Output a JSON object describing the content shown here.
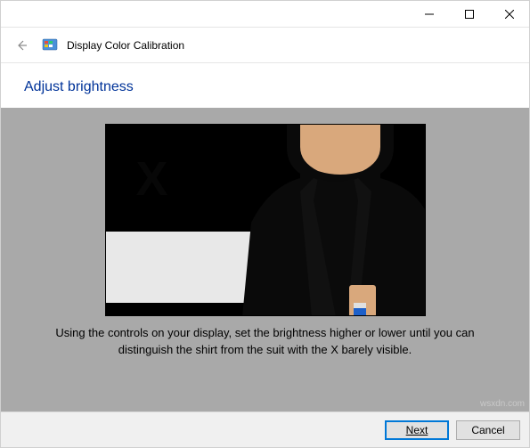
{
  "titlebar": {
    "minimize": "minimize",
    "maximize": "maximize",
    "close": "close"
  },
  "header": {
    "app_title": "Display Color Calibration"
  },
  "page": {
    "heading": "Adjust brightness",
    "instruction": "Using the controls on your display, set the brightness higher or lower until you can distinguish the shirt from the suit with the X barely visible."
  },
  "buttons": {
    "next": "Next",
    "cancel": "Cancel"
  },
  "watermark": "wsxdn.com"
}
